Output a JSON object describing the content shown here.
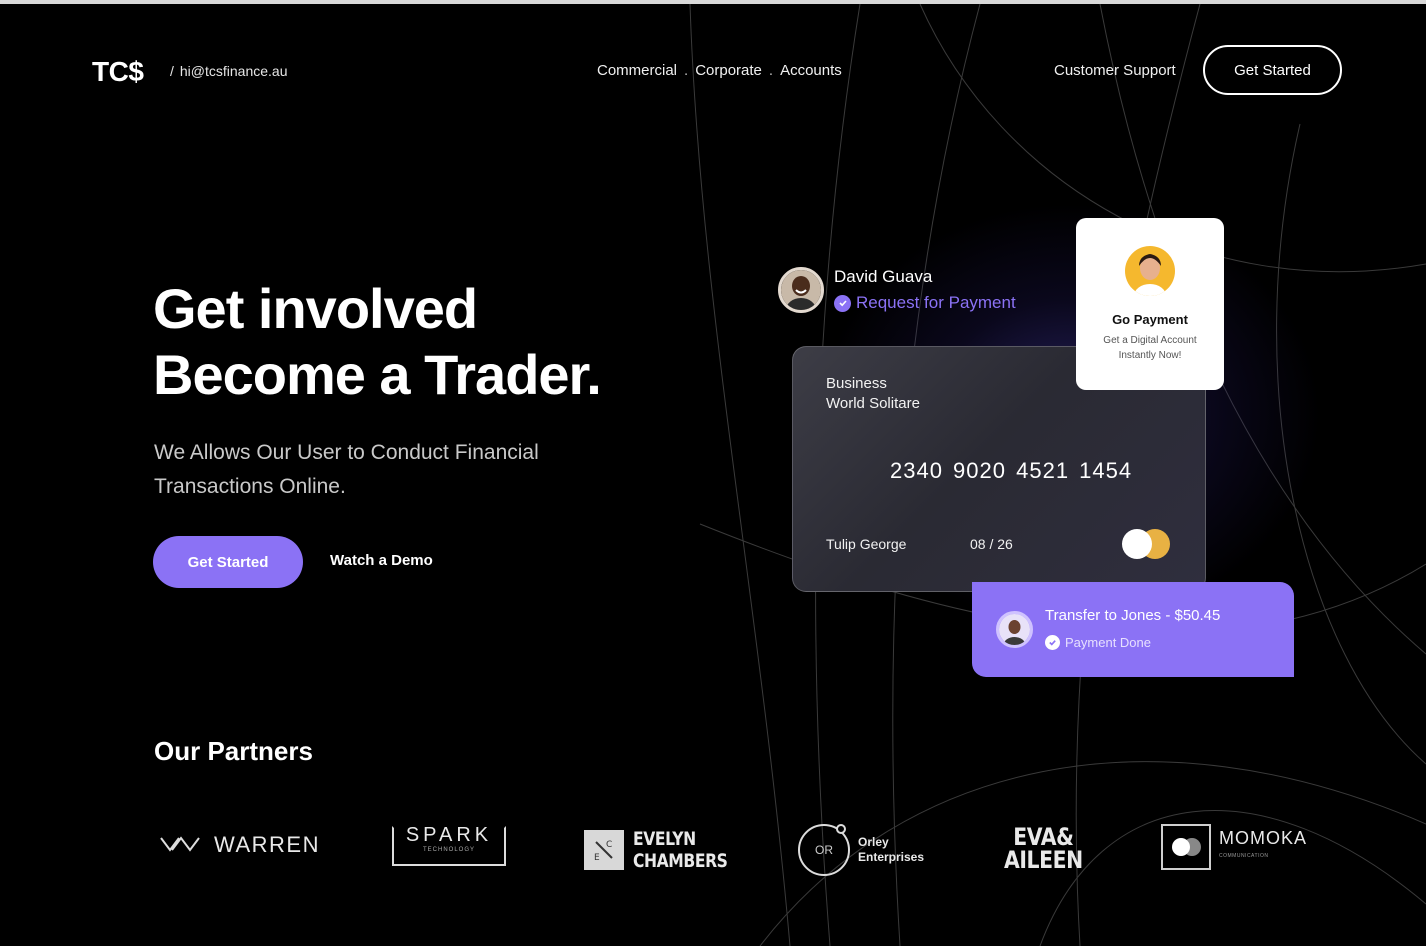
{
  "header": {
    "logo": "TC$",
    "email": "hi@tcsfinance.au",
    "nav": [
      "Commercial",
      "Corporate",
      "Accounts"
    ],
    "nav_separator": ".",
    "support": "Customer Support",
    "cta": "Get Started"
  },
  "hero": {
    "title_line1": "Get involved",
    "title_line2": "Become a Trader.",
    "subtitle": "We Allows Our User to Conduct Financial Transactions Online.",
    "primary_cta": "Get Started",
    "secondary_cta": "Watch a Demo"
  },
  "request": {
    "name": "David Guava",
    "status": "Request for Payment"
  },
  "card": {
    "type_line1": "Business",
    "type_line2": "World Solitare",
    "number": "2340 9020 4521 1454",
    "holder": "Tulip George",
    "expiry": "08 / 26"
  },
  "go_payment": {
    "title": "Go Payment",
    "description": "Get a Digital Account Instantly Now!"
  },
  "transfer": {
    "title": "Transfer to Jones - $50.45",
    "status": "Payment Done"
  },
  "partners": {
    "title": "Our Partners",
    "warren": "WARREN",
    "spark": "SPARK",
    "spark_sub": "TECHNOLOGY",
    "evelyn_line1": "EVELYN",
    "evelyn_line2": "CHAMBERS",
    "orley_badge": "OR",
    "orley_line1": "Orley",
    "orley_line2": "Enterprises",
    "eva_line1": "EVA&",
    "eva_line2": "AILEEN",
    "momoka": "MOMOKA",
    "momoka_sub": "COMMUNICATION"
  },
  "colors": {
    "background": "#000000",
    "accent": "#8b72f5",
    "card_chip_gold": "#f2b843"
  }
}
